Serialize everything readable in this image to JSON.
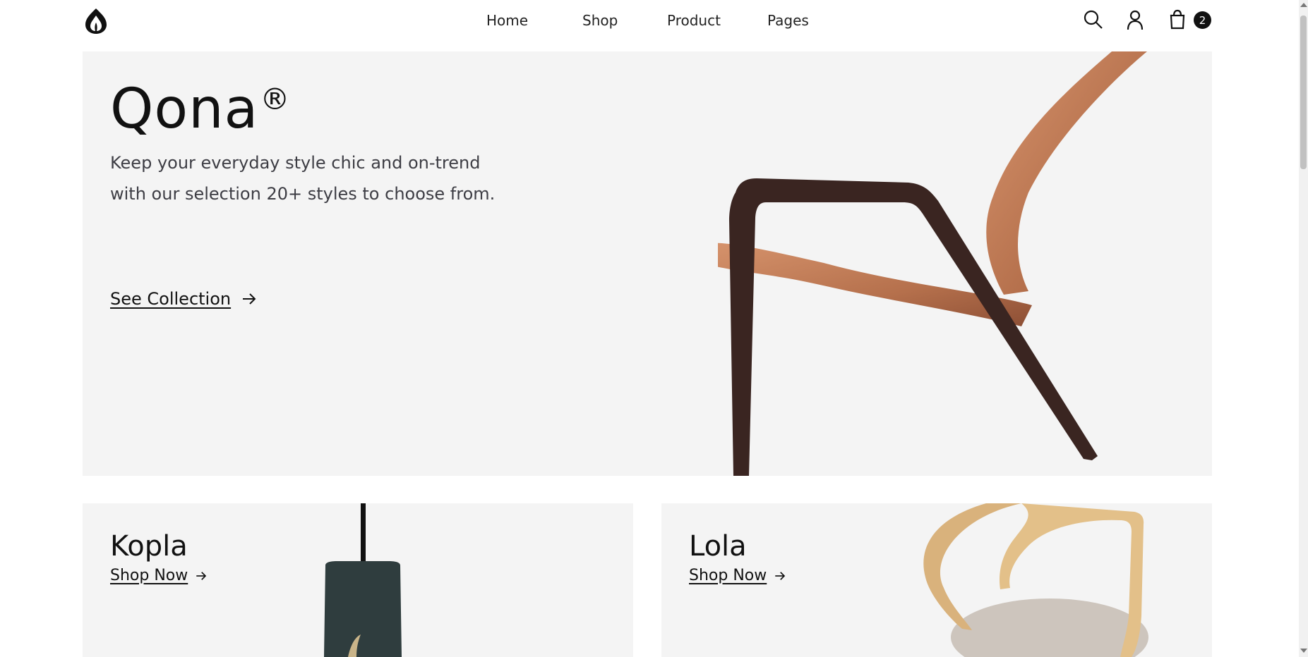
{
  "header": {
    "logo_icon": "flame-drop-logo-icon",
    "nav": [
      {
        "label": "Home"
      },
      {
        "label": "Shop"
      },
      {
        "label": "Product"
      },
      {
        "label": "Pages"
      }
    ],
    "icons": [
      "search-icon",
      "user-icon",
      "shopping-bag-icon"
    ],
    "cart_count": "2"
  },
  "hero": {
    "title": "Qona",
    "registered": "®",
    "description": "Keep your everyday style chic and on-trend with our selection 20+ styles to choose from.",
    "cta_label": "See Collection",
    "cta_icon": "arrow-right-icon"
  },
  "cards": [
    {
      "title": "Kopla",
      "cta_label": "Shop Now"
    },
    {
      "title": "Lola",
      "cta_label": "Shop Now"
    }
  ],
  "colors": {
    "panel_bg": "#f4f4f4",
    "text": "#111111",
    "muted_text": "#3d3d44"
  }
}
